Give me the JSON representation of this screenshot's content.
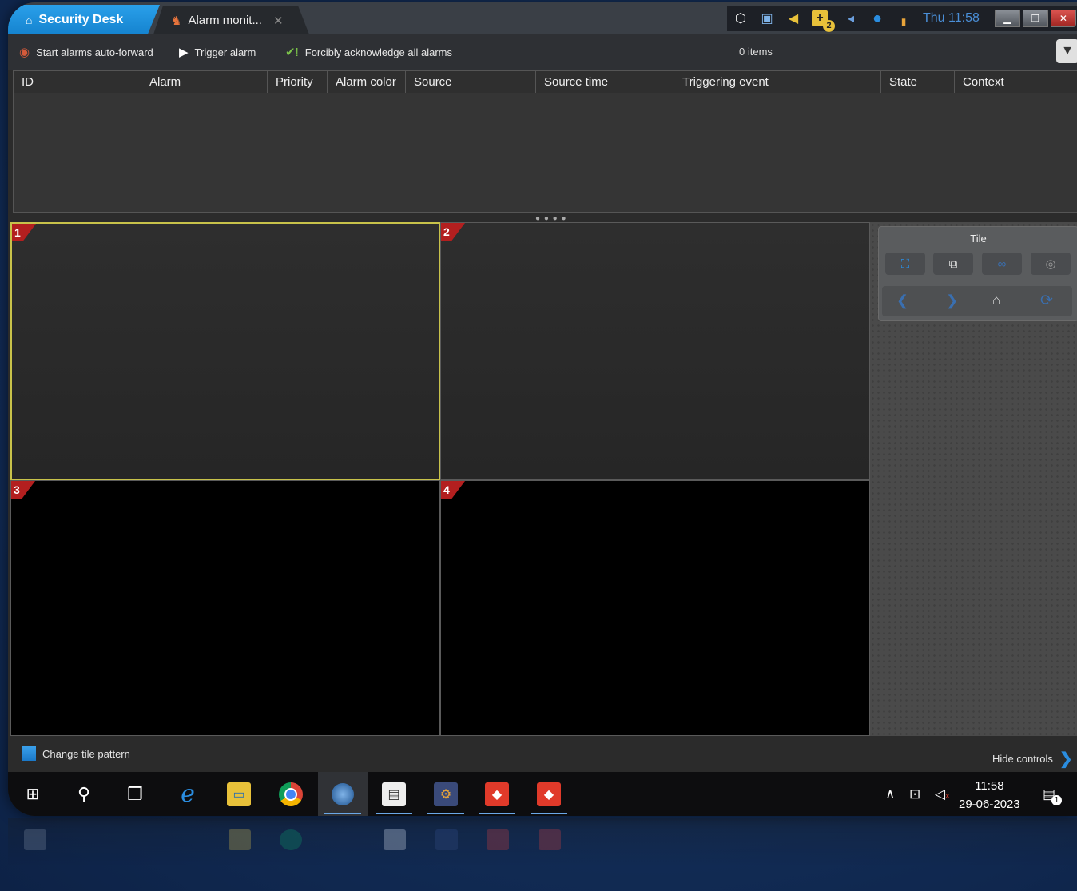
{
  "titlebar": {
    "app_tab_label": "Security Desk",
    "task_tab_label": "Alarm monit...",
    "tray_badge": "2",
    "clock": "Thu 11:58"
  },
  "toolbar": {
    "auto_forward_label": "Start alarms auto-forward",
    "trigger_label": "Trigger alarm",
    "ack_all_label": "Forcibly acknowledge all alarms",
    "items_count": "0 items"
  },
  "table": {
    "columns": [
      "ID",
      "Alarm",
      "Priority",
      "Alarm color",
      "Source",
      "Source time",
      "Triggering event",
      "State",
      "Context"
    ]
  },
  "tiles": [
    {
      "number": "1"
    },
    {
      "number": "2"
    },
    {
      "number": "3"
    },
    {
      "number": "4"
    }
  ],
  "side_panel": {
    "tile_label": "Tile"
  },
  "bottom": {
    "change_pattern_label": "Change tile pattern",
    "hide_controls_label": "Hide controls"
  },
  "taskbar": {
    "time": "11:58",
    "date": "29-06-2023",
    "notification_count": "1"
  },
  "colors": {
    "accent_blue": "#1583cf",
    "tile_number_red": "#b31f1f",
    "selected_tile_border": "#c8c24a"
  }
}
